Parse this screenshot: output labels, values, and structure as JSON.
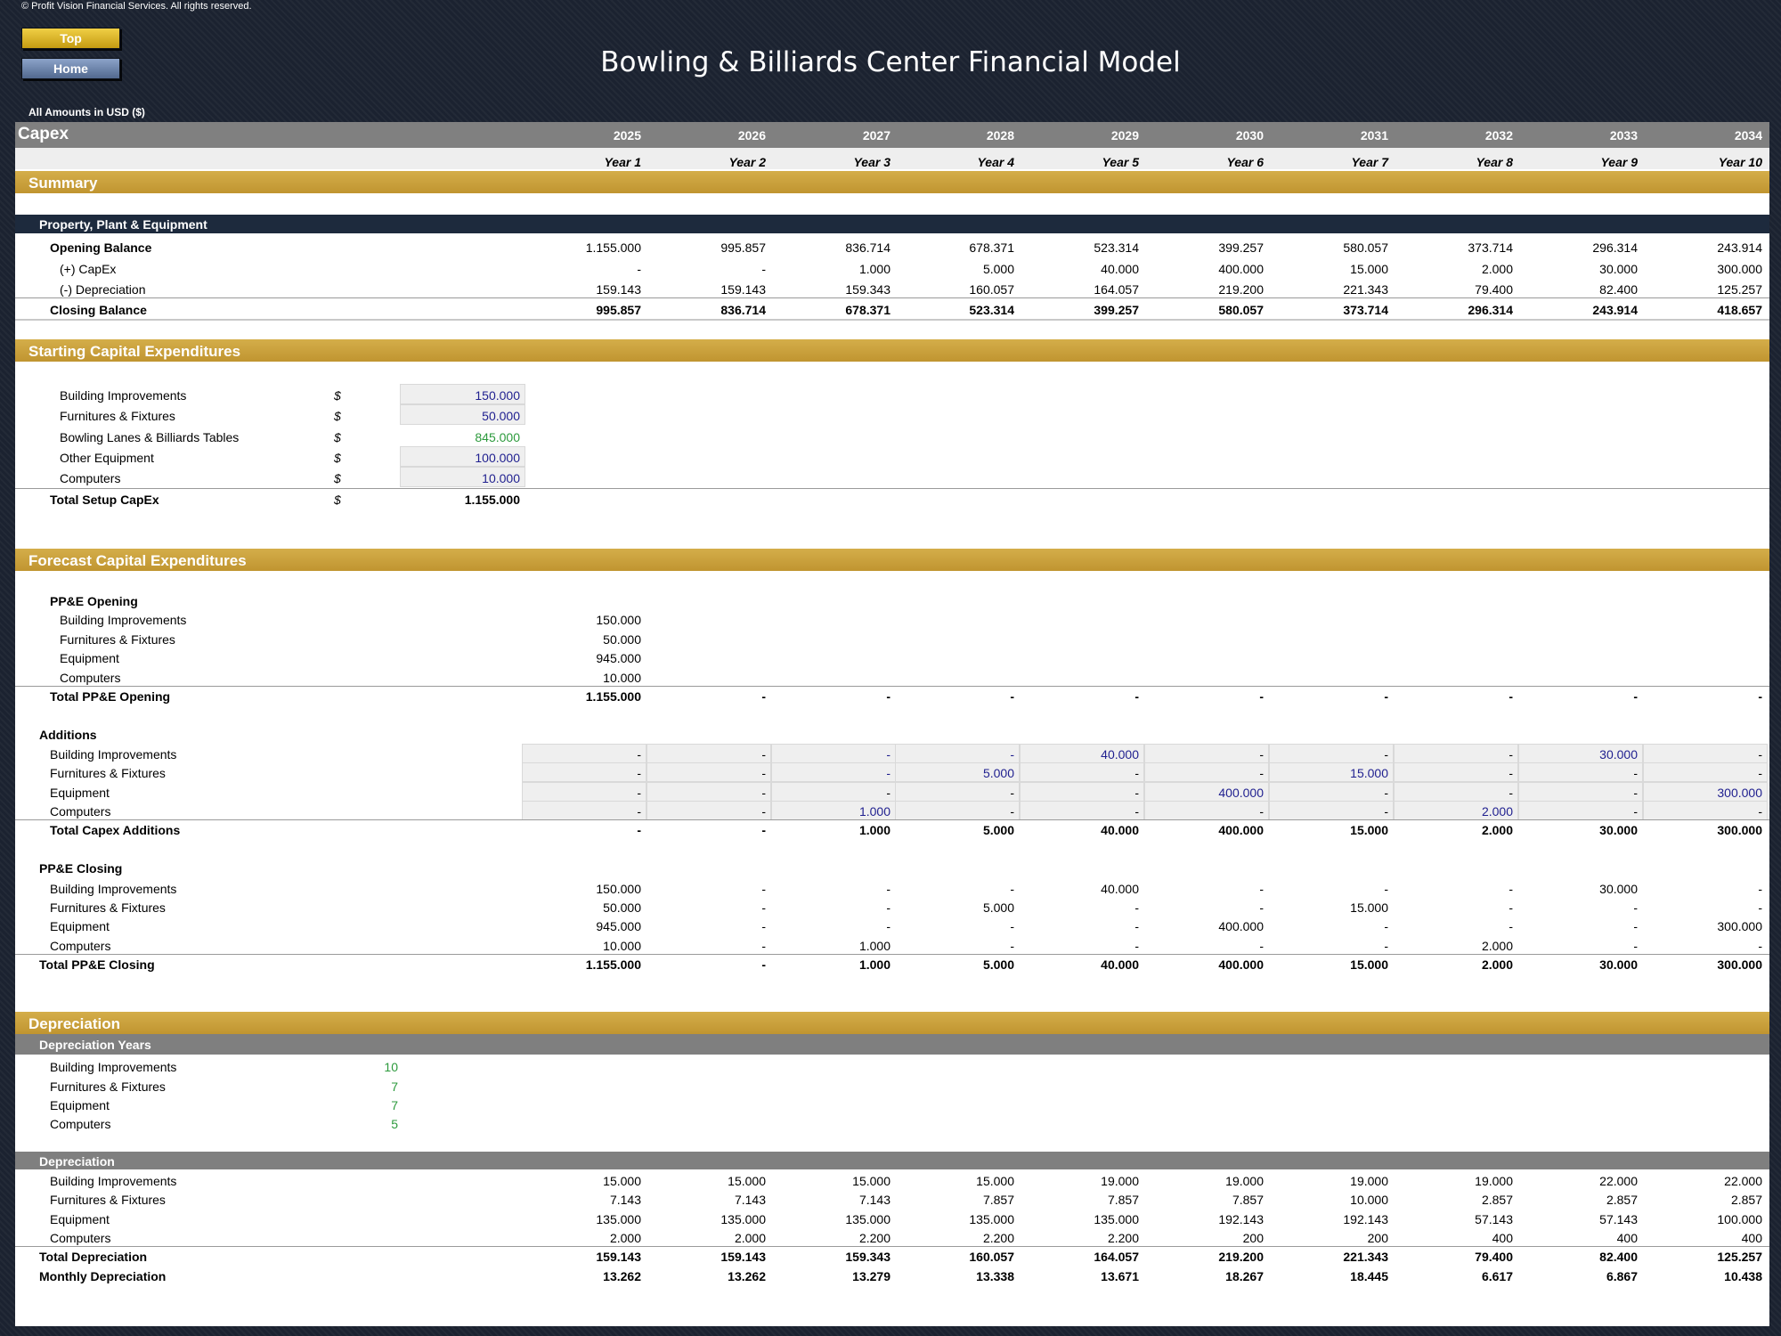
{
  "copyright": "© Profit Vision Financial Services. All rights reserved.",
  "nav": {
    "top": "Top",
    "home": "Home"
  },
  "title": "Bowling & Billiards Center Financial Model",
  "amounts_label": "All Amounts in  USD ($)",
  "sheet_name": "Capex",
  "years": [
    "2025",
    "2026",
    "2027",
    "2028",
    "2029",
    "2030",
    "2031",
    "2032",
    "2033",
    "2034"
  ],
  "year_labels": [
    "Year 1",
    "Year 2",
    "Year 3",
    "Year 4",
    "Year 5",
    "Year 6",
    "Year 7",
    "Year 8",
    "Year 9",
    "Year 10"
  ],
  "summary": {
    "title": "Summary",
    "subtitle": "Property, Plant & Equipment",
    "rows": [
      {
        "label": "Opening Balance",
        "values": [
          "1.155.000",
          "995.857",
          "836.714",
          "678.371",
          "523.314",
          "399.257",
          "580.057",
          "373.714",
          "296.314",
          "243.914"
        ]
      },
      {
        "label": "(+) CapEx",
        "values": [
          "-",
          "-",
          "1.000",
          "5.000",
          "40.000",
          "400.000",
          "15.000",
          "2.000",
          "30.000",
          "300.000"
        ]
      },
      {
        "label": "(-) Depreciation",
        "values": [
          "159.143",
          "159.143",
          "159.343",
          "160.057",
          "164.057",
          "219.200",
          "221.343",
          "79.400",
          "82.400",
          "125.257"
        ]
      },
      {
        "label": "Closing Balance",
        "values": [
          "995.857",
          "836.714",
          "678.371",
          "523.314",
          "399.257",
          "580.057",
          "373.714",
          "296.314",
          "243.914",
          "418.657"
        ]
      }
    ]
  },
  "starting": {
    "title": "Starting Capital Expenditures",
    "currency": "$",
    "items": [
      {
        "label": "Building Improvements",
        "value": "150.000"
      },
      {
        "label": "Furnitures & Fixtures",
        "value": "50.000"
      },
      {
        "label": "Bowling Lanes & Billiards Tables",
        "value": "845.000"
      },
      {
        "label": "Other Equipment",
        "value": "100.000"
      },
      {
        "label": "Computers",
        "value": "10.000"
      }
    ],
    "total_label": "Total Setup CapEx",
    "total_value": "1.155.000"
  },
  "forecast": {
    "title": "Forecast Capital Expenditures",
    "opening": {
      "heading": "PP&E Opening",
      "items": [
        {
          "label": "Building Improvements",
          "value": "150.000"
        },
        {
          "label": "Furnitures & Fixtures",
          "value": "50.000"
        },
        {
          "label": "Equipment",
          "value": "945.000"
        },
        {
          "label": "Computers",
          "value": "10.000"
        }
      ],
      "total_label": "Total PP&E Opening",
      "total_values": [
        "1.155.000",
        "-",
        "-",
        "-",
        "-",
        "-",
        "-",
        "-",
        "-",
        "-"
      ]
    },
    "additions": {
      "heading": "Additions",
      "rows": [
        {
          "label": "Building Improvements",
          "values": [
            "-",
            "-",
            "-",
            "-",
            "40.000",
            "-",
            "-",
            "-",
            "30.000",
            "-"
          ]
        },
        {
          "label": "Furnitures & Fixtures",
          "values": [
            "-",
            "-",
            "-",
            "5.000",
            "-",
            "-",
            "15.000",
            "-",
            "-",
            "-"
          ]
        },
        {
          "label": "Equipment",
          "values": [
            "-",
            "-",
            "-",
            "-",
            "-",
            "400.000",
            "-",
            "-",
            "-",
            "300.000"
          ]
        },
        {
          "label": "Computers",
          "values": [
            "-",
            "-",
            "1.000",
            "-",
            "-",
            "-",
            "-",
            "2.000",
            "-",
            "-"
          ]
        }
      ],
      "total_label": "Total Capex Additions",
      "total_values": [
        "-",
        "-",
        "1.000",
        "5.000",
        "40.000",
        "400.000",
        "15.000",
        "2.000",
        "30.000",
        "300.000"
      ]
    },
    "closing": {
      "heading": "PP&E Closing",
      "rows": [
        {
          "label": "Building Improvements",
          "values": [
            "150.000",
            "-",
            "-",
            "-",
            "40.000",
            "-",
            "-",
            "-",
            "30.000",
            "-"
          ]
        },
        {
          "label": "Furnitures & Fixtures",
          "values": [
            "50.000",
            "-",
            "-",
            "5.000",
            "-",
            "-",
            "15.000",
            "-",
            "-",
            "-"
          ]
        },
        {
          "label": "Equipment",
          "values": [
            "945.000",
            "-",
            "-",
            "-",
            "-",
            "400.000",
            "-",
            "-",
            "-",
            "300.000"
          ]
        },
        {
          "label": "Computers",
          "values": [
            "10.000",
            "-",
            "1.000",
            "-",
            "-",
            "-",
            "-",
            "2.000",
            "-",
            "-"
          ]
        }
      ],
      "total_label": "Total PP&E Closing",
      "total_values": [
        "1.155.000",
        "-",
        "1.000",
        "5.000",
        "40.000",
        "400.000",
        "15.000",
        "2.000",
        "30.000",
        "300.000"
      ]
    }
  },
  "depreciation": {
    "title": "Depreciation",
    "years_heading": "Depreciation Years",
    "years_items": [
      {
        "label": "Building Improvements",
        "value": "10"
      },
      {
        "label": "Furnitures & Fixtures",
        "value": "7"
      },
      {
        "label": "Equipment",
        "value": "7"
      },
      {
        "label": "Computers",
        "value": "5"
      }
    ],
    "dep_heading": "Depreciation",
    "rows": [
      {
        "label": "Building Improvements",
        "values": [
          "15.000",
          "15.000",
          "15.000",
          "15.000",
          "19.000",
          "19.000",
          "19.000",
          "19.000",
          "22.000",
          "22.000"
        ]
      },
      {
        "label": "Furnitures & Fixtures",
        "values": [
          "7.143",
          "7.143",
          "7.143",
          "7.857",
          "7.857",
          "7.857",
          "10.000",
          "2.857",
          "2.857",
          "2.857"
        ]
      },
      {
        "label": "Equipment",
        "values": [
          "135.000",
          "135.000",
          "135.000",
          "135.000",
          "135.000",
          "192.143",
          "192.143",
          "57.143",
          "57.143",
          "100.000"
        ]
      },
      {
        "label": "Computers",
        "values": [
          "2.000",
          "2.000",
          "2.200",
          "2.200",
          "2.200",
          "200",
          "200",
          "400",
          "400",
          "400"
        ]
      }
    ],
    "total_label": "Total Depreciation",
    "total_values": [
      "159.143",
      "159.143",
      "159.343",
      "160.057",
      "164.057",
      "219.200",
      "221.343",
      "79.400",
      "82.400",
      "125.257"
    ],
    "monthly_label": "Monthly Depreciation",
    "monthly_values": [
      "13.262",
      "13.262",
      "13.279",
      "13.338",
      "13.671",
      "18.267",
      "18.445",
      "6.617",
      "6.867",
      "10.438"
    ]
  },
  "colors": {
    "gold_band": "#c9a23c",
    "navy_band": "#1d2a3d",
    "input_blue": "#1f1f8f",
    "input_green": "#2c9a3c",
    "background": "#1b2230"
  }
}
